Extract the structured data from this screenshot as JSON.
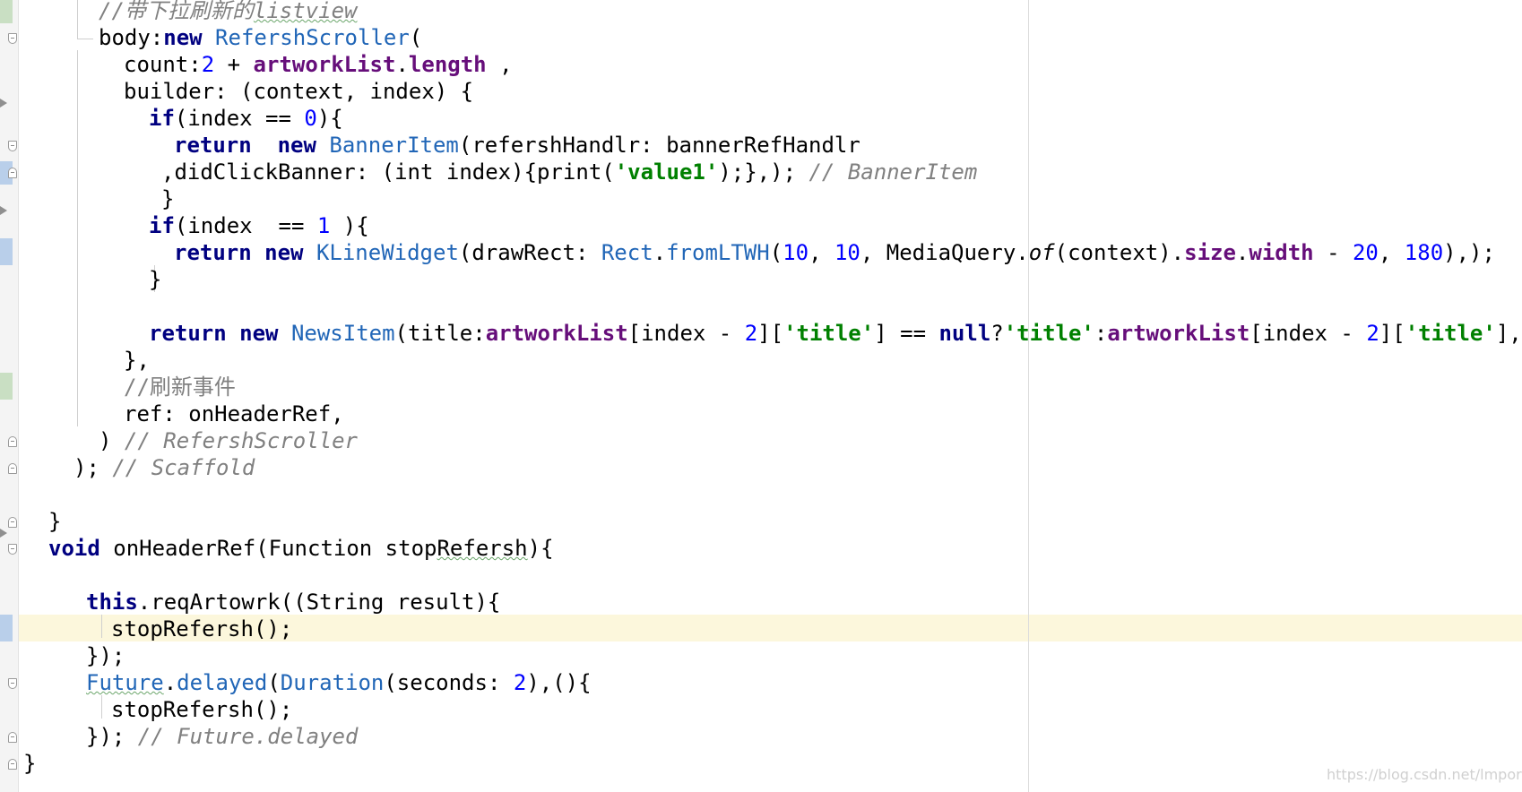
{
  "editor": {
    "lines": [
      {
        "id": "c01",
        "tokens": [
          {
            "t": "//带下拉刷新的",
            "c": "cmt"
          },
          {
            "t": "listview",
            "c": "cmt squiggle"
          }
        ]
      },
      {
        "id": "c02",
        "tokens": [
          {
            "t": "body:",
            "c": ""
          },
          {
            "t": "new ",
            "c": "kw"
          },
          {
            "t": "RefershScroller",
            "c": "cls"
          },
          {
            "t": "(",
            "c": ""
          }
        ]
      },
      {
        "id": "c03",
        "tokens": [
          {
            "t": "count:",
            "c": ""
          },
          {
            "t": "2",
            "c": "num"
          },
          {
            "t": " + ",
            "c": ""
          },
          {
            "t": "artworkList",
            "c": "prop"
          },
          {
            "t": ".",
            "c": ""
          },
          {
            "t": "length",
            "c": "prop"
          },
          {
            "t": " ,",
            "c": ""
          }
        ]
      },
      {
        "id": "c04",
        "tokens": [
          {
            "t": "builder: (context, index) {",
            "c": ""
          }
        ]
      },
      {
        "id": "c05",
        "tokens": [
          {
            "t": "if",
            "c": "kw"
          },
          {
            "t": "(index == ",
            "c": ""
          },
          {
            "t": "0",
            "c": "num"
          },
          {
            "t": "){",
            "c": ""
          }
        ]
      },
      {
        "id": "c06",
        "tokens": [
          {
            "t": "return  ",
            "c": "kw"
          },
          {
            "t": "new ",
            "c": "kw"
          },
          {
            "t": "BannerItem",
            "c": "cls"
          },
          {
            "t": "(refershHandlr: bannerRefHandlr",
            "c": ""
          }
        ]
      },
      {
        "id": "c07",
        "tokens": [
          {
            "t": ",didClickBanner: (int index){print(",
            "c": ""
          },
          {
            "t": "'value1'",
            "c": "str"
          },
          {
            "t": ");},); ",
            "c": ""
          },
          {
            "t": "// BannerItem",
            "c": "cmt"
          }
        ]
      },
      {
        "id": "c08",
        "tokens": [
          {
            "t": "}",
            "c": ""
          }
        ]
      },
      {
        "id": "c09",
        "tokens": [
          {
            "t": "if",
            "c": "kw"
          },
          {
            "t": "(index  == ",
            "c": ""
          },
          {
            "t": "1",
            "c": "num"
          },
          {
            "t": " ){",
            "c": ""
          }
        ]
      },
      {
        "id": "c10",
        "tokens": [
          {
            "t": "return ",
            "c": "kw"
          },
          {
            "t": "new ",
            "c": "kw"
          },
          {
            "t": "KLineWidget",
            "c": "cls"
          },
          {
            "t": "(drawRect: ",
            "c": ""
          },
          {
            "t": "Rect",
            "c": "cls"
          },
          {
            "t": ".",
            "c": ""
          },
          {
            "t": "fromLTWH",
            "c": "cls"
          },
          {
            "t": "(",
            "c": ""
          },
          {
            "t": "10",
            "c": "num"
          },
          {
            "t": ", ",
            "c": ""
          },
          {
            "t": "10",
            "c": "num"
          },
          {
            "t": ", MediaQuery.",
            "c": ""
          },
          {
            "t": "of",
            "c": "ital"
          },
          {
            "t": "(context).",
            "c": ""
          },
          {
            "t": "size",
            "c": "prop"
          },
          {
            "t": ".",
            "c": ""
          },
          {
            "t": "width",
            "c": "prop"
          },
          {
            "t": " - ",
            "c": ""
          },
          {
            "t": "20",
            "c": "num"
          },
          {
            "t": ", ",
            "c": ""
          },
          {
            "t": "180",
            "c": "num"
          },
          {
            "t": "),);",
            "c": ""
          }
        ]
      },
      {
        "id": "c11",
        "tokens": [
          {
            "t": "}",
            "c": ""
          }
        ]
      },
      {
        "id": "c12",
        "tokens": [
          {
            "t": "return ",
            "c": "kw"
          },
          {
            "t": "new ",
            "c": "kw"
          },
          {
            "t": "NewsItem",
            "c": "cls"
          },
          {
            "t": "(title:",
            "c": ""
          },
          {
            "t": "artworkList",
            "c": "prop"
          },
          {
            "t": "[index - ",
            "c": ""
          },
          {
            "t": "2",
            "c": "num"
          },
          {
            "t": "][",
            "c": ""
          },
          {
            "t": "'title'",
            "c": "str"
          },
          {
            "t": "] == ",
            "c": ""
          },
          {
            "t": "null",
            "c": "kw"
          },
          {
            "t": "?",
            "c": ""
          },
          {
            "t": "'title'",
            "c": "str"
          },
          {
            "t": ":",
            "c": ""
          },
          {
            "t": "artworkList",
            "c": "prop"
          },
          {
            "t": "[index - ",
            "c": ""
          },
          {
            "t": "2",
            "c": "num"
          },
          {
            "t": "][",
            "c": ""
          },
          {
            "t": "'title'",
            "c": "str"
          },
          {
            "t": "],imag",
            "c": ""
          }
        ]
      },
      {
        "id": "c13",
        "tokens": [
          {
            "t": "},",
            "c": ""
          }
        ]
      },
      {
        "id": "c14",
        "tokens": [
          {
            "t": "//刷新事件",
            "c": "cmt-cn"
          }
        ]
      },
      {
        "id": "c15",
        "tokens": [
          {
            "t": "ref: onHeaderRef,",
            "c": ""
          }
        ]
      },
      {
        "id": "c16",
        "tokens": [
          {
            "t": ") ",
            "c": ""
          },
          {
            "t": "// RefershScroller",
            "c": "cmt"
          }
        ]
      },
      {
        "id": "c17",
        "tokens": [
          {
            "t": "); ",
            "c": ""
          },
          {
            "t": "// Scaffold",
            "c": "cmt"
          }
        ]
      },
      {
        "id": "c18",
        "tokens": [
          {
            "t": "}",
            "c": ""
          }
        ]
      },
      {
        "id": "c19",
        "tokens": [
          {
            "t": "void ",
            "c": "kw"
          },
          {
            "t": "onHeaderRef(Function stop",
            "c": ""
          },
          {
            "t": "Refersh",
            "c": "squiggle"
          },
          {
            "t": "){",
            "c": ""
          }
        ]
      },
      {
        "id": "c20",
        "tokens": [
          {
            "t": "this",
            "c": "kw"
          },
          {
            "t": ".reqArtowrk((String result){",
            "c": ""
          }
        ]
      },
      {
        "id": "c21",
        "tokens": [
          {
            "t": "stopRefersh();",
            "c": ""
          }
        ]
      },
      {
        "id": "c22",
        "tokens": [
          {
            "t": "});",
            "c": ""
          }
        ]
      },
      {
        "id": "c23",
        "tokens": [
          {
            "t": "Future",
            "c": "cls squiggle"
          },
          {
            "t": ".",
            "c": ""
          },
          {
            "t": "delayed",
            "c": "cls"
          },
          {
            "t": "(",
            "c": ""
          },
          {
            "t": "Duration",
            "c": "cls"
          },
          {
            "t": "(seconds: ",
            "c": ""
          },
          {
            "t": "2",
            "c": "num"
          },
          {
            "t": "),(){",
            "c": ""
          }
        ]
      },
      {
        "id": "c24",
        "tokens": [
          {
            "t": "stopRefersh();",
            "c": ""
          }
        ]
      },
      {
        "id": "c25",
        "tokens": [
          {
            "t": "}); ",
            "c": ""
          },
          {
            "t": "// Future.delayed",
            "c": "cmt"
          }
        ]
      },
      {
        "id": "c26",
        "tokens": [
          {
            "t": "}",
            "c": ""
          }
        ]
      }
    ]
  },
  "watermark": "https://blog.csdn.net/lmporling"
}
